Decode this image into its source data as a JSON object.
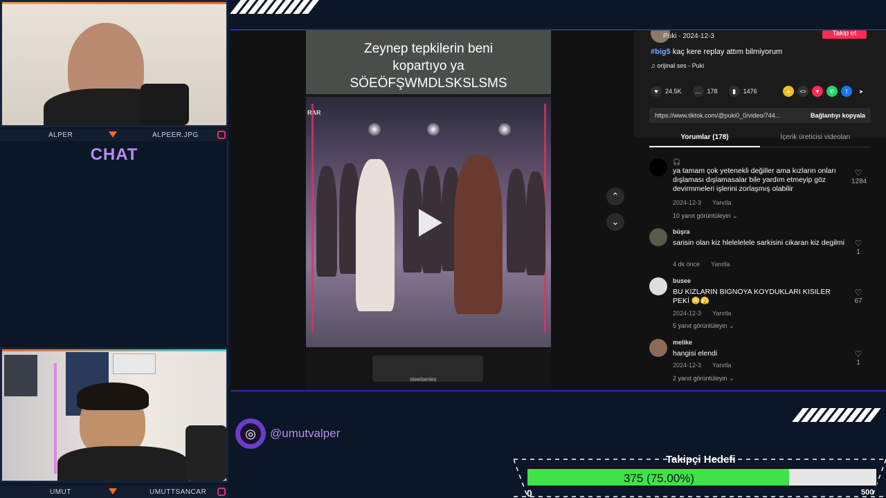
{
  "streamer_top": {
    "left_name": "ALPER",
    "right_name": "ALPEER.JPG"
  },
  "streamer_bottom": {
    "left_name": "UMUT",
    "right_name": "UMUTTSANCAR"
  },
  "chat": {
    "title": "CHAT"
  },
  "video": {
    "caption_lines": [
      "Zeynep tepkilerin beni",
      "kopartıyo ya",
      "SÖEÖFŞWMDLSKSLSMS"
    ],
    "corner_label": "RAR",
    "keyboard_label": "steelseries"
  },
  "post": {
    "author": "Puki · 2024-12-3",
    "follow_label": "Takip et",
    "hashtag": "#big5",
    "description": "kaç kere replay attım bilmiyorum",
    "music": "orijinal ses - Puki",
    "likes": "24.5K",
    "comments": "178",
    "saves": "1476",
    "url": "https://www.tiktok.com/@puki0_0/video/744...",
    "copy_label": "Bağlantıyı kopyala",
    "tab_comments": "Yorumlar (178)",
    "tab_creator": "İçerik üreticisi videoları"
  },
  "comments": [
    {
      "user": "🎧",
      "text": "ya tamam çok yetenekli değiller ama kızların onları dışlaması dışlamasalar bile yardım etmeyip göz devirmmeleri işlerini zorlaşmış olabilir",
      "date": "2024-12-3",
      "reply": "Yanıtla",
      "replies": "10 yanıt görüntüleyin",
      "likes": "1284"
    },
    {
      "user": "büşra",
      "text": "sarisin olan kiz hlelelelele sarkisini cikaran kiz degilmi",
      "date": "4 dk önce",
      "reply": "Yanıtla",
      "replies": "",
      "likes": "1"
    },
    {
      "user": "busee",
      "text": "BU KIZLARIN BIGNOYA KOYDUKLARI KISILER PEKİ 😳🫣",
      "date": "2024-12-3",
      "reply": "Yanıtla",
      "replies": "5 yanıt görüntüleyin",
      "likes": "67"
    },
    {
      "user": "melike",
      "text": "hangisi elendi",
      "date": "2024-12-3",
      "reply": "Yanıtla",
      "replies": "2 yanıt görüntüleyin",
      "likes": "1"
    }
  ],
  "handle": "@umutvalper",
  "goal": {
    "title": "Takipçi Hedefi",
    "text": "375 (75.00%)",
    "min": "0",
    "max": "500",
    "progress": 0.75
  }
}
